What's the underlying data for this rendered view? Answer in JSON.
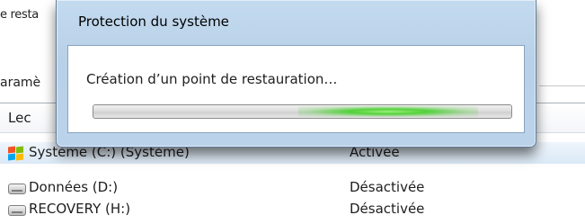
{
  "background": {
    "top_fragment": "e resta",
    "param_fragment": "aramè",
    "list": {
      "header_col1": "Lec",
      "rows": [
        {
          "name": "Système (C:) (Système)",
          "status": "Activée",
          "icon": "windows-drive-icon"
        },
        {
          "name": "Données (D:)",
          "status": "Désactivée",
          "icon": "drive-icon"
        },
        {
          "name": "RECOVERY (H:)",
          "status": "Désactivée",
          "icon": "drive-icon"
        }
      ]
    }
  },
  "dialog": {
    "title": "Protection du système",
    "message": "Création d’un point de restauration…",
    "progress": "indeterminate"
  }
}
